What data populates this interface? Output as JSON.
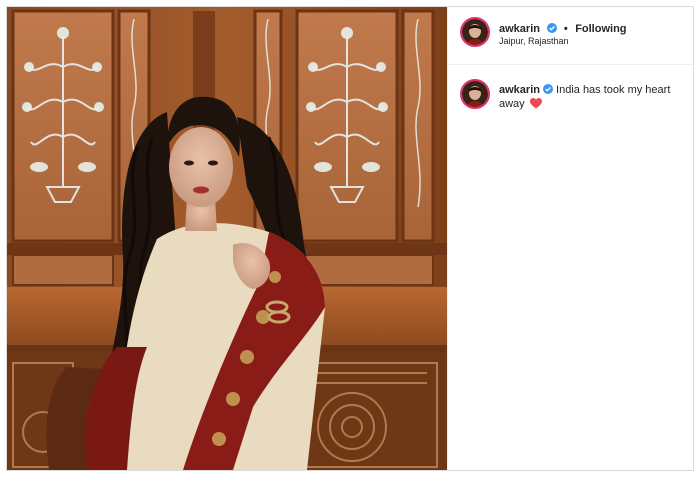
{
  "post": {
    "username": "awkarin",
    "separator": "•",
    "follow_status": "Following",
    "location": "Jaipur, Rajasthan",
    "verified_icon": "verified-badge-icon",
    "colors": {
      "verified": "#3897f0",
      "avatar_ring": "#e1306c",
      "heart": "#ed4956"
    }
  },
  "caption": {
    "username": "awkarin",
    "text": "India has took my heart away",
    "emoji_icon": "red-heart-icon"
  }
}
